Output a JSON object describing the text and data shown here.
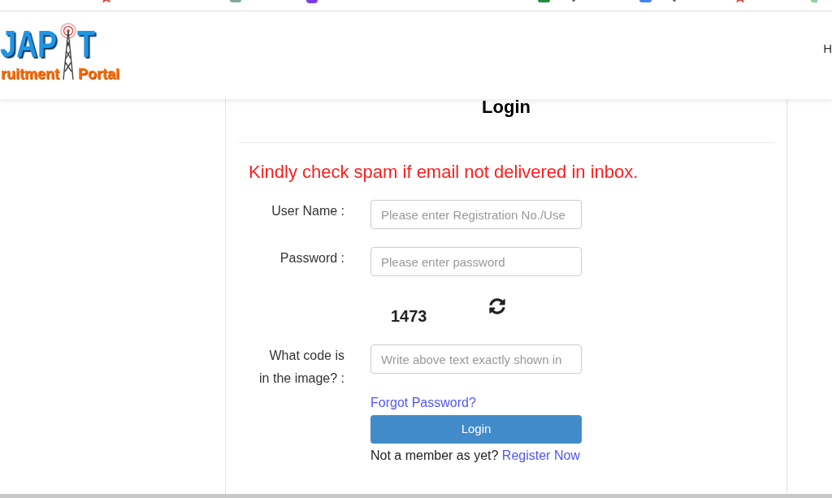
{
  "header": {
    "logo": {
      "title": "JAP",
      "title_end": "T",
      "subtitle": "ruitment",
      "subtitle_end": "Portal"
    },
    "nav": [
      "H"
    ]
  },
  "login_card": {
    "title": "Login",
    "notice": "Kindly check spam if email not delivered in inbox.",
    "fields": [
      {
        "kind": "text",
        "label": "User Name :",
        "placeholder": "Please enter Registration No./Use"
      },
      {
        "kind": "password",
        "label": "Password :",
        "placeholder": "Please enter password"
      },
      {
        "kind": "captcha",
        "label": "What code is\nin the image? :",
        "placeholder": "Write above text exactly shown in",
        "code": "1473"
      }
    ],
    "forgot_link": "Forgot Password?",
    "submit": "Login",
    "register_prompt": "Not a member as yet?",
    "register_link": "Register Now"
  }
}
